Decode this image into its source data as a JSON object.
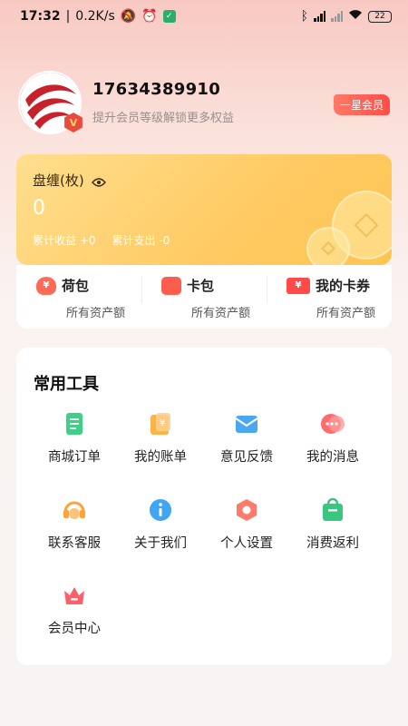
{
  "status_bar": {
    "time": "17:32",
    "net_speed": "0.2K/s",
    "battery": "22"
  },
  "profile": {
    "phone": "17634389910",
    "upgrade_tip": "提升会员等级解锁更多权益",
    "level": "一星会员",
    "vip_mark": "V"
  },
  "balance": {
    "title": "盘缠(枚)",
    "amount": "0",
    "income_label": "累计收益 +0",
    "expense_label": "累计支出 -0"
  },
  "wallet": [
    {
      "label": "荷包",
      "sub": "所有资产额",
      "icon": "pouch-icon",
      "color": "#ff6a55"
    },
    {
      "label": "卡包",
      "sub": "所有资产额",
      "icon": "wallet-icon",
      "color": "#ff5d4d"
    },
    {
      "label": "我的卡券",
      "sub": "所有资产额",
      "icon": "ticket-icon",
      "color": "#ff4a4a"
    }
  ],
  "tools": {
    "title": "常用工具",
    "items": [
      {
        "label": "商城订单",
        "icon": "order-icon",
        "color": "#3fcf86"
      },
      {
        "label": "我的账单",
        "icon": "bill-icon",
        "color": "#ffb246"
      },
      {
        "label": "意见反馈",
        "icon": "mail-icon",
        "color": "#4aa8f2"
      },
      {
        "label": "我的消息",
        "icon": "message-icon",
        "color": "#ff6b6b"
      },
      {
        "label": "联系客服",
        "icon": "headset-icon",
        "color": "#ffa238"
      },
      {
        "label": "关于我们",
        "icon": "info-icon",
        "color": "#3ea6f5"
      },
      {
        "label": "个人设置",
        "icon": "settings-icon",
        "color": "#ff7a6b"
      },
      {
        "label": "消费返利",
        "icon": "rebate-icon",
        "color": "#3bc680"
      },
      {
        "label": "会员中心",
        "icon": "vip-center-icon",
        "color": "#ff5f66"
      }
    ]
  }
}
